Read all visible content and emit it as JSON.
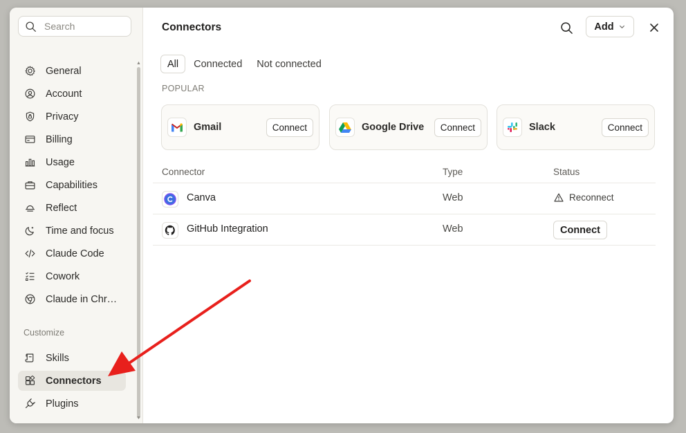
{
  "sidebar": {
    "search_placeholder": "Search",
    "items": [
      {
        "label": "General",
        "icon": "gear-icon"
      },
      {
        "label": "Account",
        "icon": "user-circle-icon"
      },
      {
        "label": "Privacy",
        "icon": "shield-icon"
      },
      {
        "label": "Billing",
        "icon": "credit-card-icon"
      },
      {
        "label": "Usage",
        "icon": "bar-chart-icon"
      },
      {
        "label": "Capabilities",
        "icon": "toolbox-icon"
      },
      {
        "label": "Reflect",
        "icon": "sunrise-icon"
      },
      {
        "label": "Time and focus",
        "icon": "moon-icon"
      },
      {
        "label": "Claude Code",
        "icon": "code-icon"
      },
      {
        "label": "Cowork",
        "icon": "checklist-icon"
      },
      {
        "label": "Claude in Chr…",
        "icon": "globe-icon"
      }
    ],
    "group_label": "Customize",
    "custom_items": [
      {
        "label": "Skills",
        "icon": "scroll-icon"
      },
      {
        "label": "Connectors",
        "icon": "connectors-icon",
        "active": true
      },
      {
        "label": "Plugins",
        "icon": "plug-icon"
      }
    ]
  },
  "header": {
    "title": "Connectors",
    "add_label": "Add"
  },
  "tabs": [
    "All",
    "Connected",
    "Not connected"
  ],
  "popular": {
    "label": "POPULAR",
    "cards": [
      {
        "name": "Gmail",
        "button": "Connect",
        "icon": "gmail-icon"
      },
      {
        "name": "Google Drive",
        "button": "Connect",
        "icon": "google-drive-icon"
      },
      {
        "name": "Slack",
        "button": "Connect",
        "icon": "slack-icon"
      }
    ]
  },
  "table": {
    "headers": [
      "Connector",
      "Type",
      "Status"
    ],
    "rows": [
      {
        "name": "Canva",
        "type": "Web",
        "status": "Reconnect",
        "icon": "canva-icon",
        "status_icon": "warning-icon"
      },
      {
        "name": "GitHub Integration",
        "type": "Web",
        "status": "Connect",
        "icon": "github-icon"
      }
    ]
  },
  "colors": {
    "annotation_arrow": "#e8201c",
    "gmail_red": "#ea4335",
    "canva_blue": "#3b6fe0"
  }
}
